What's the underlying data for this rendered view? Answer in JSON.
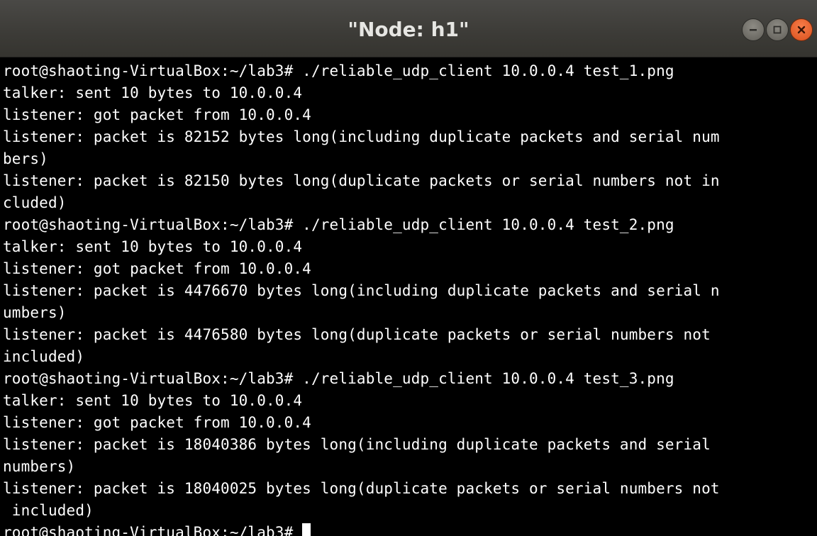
{
  "window": {
    "title": "\"Node: h1\"",
    "controls": {
      "minimize_icon": "minimize-icon",
      "maximize_icon": "maximize-icon",
      "close_icon": "close-icon"
    },
    "colors": {
      "titlebar": "#3d3c38",
      "close_button": "#e9612a",
      "terminal_bg": "#000000",
      "terminal_fg": "#ffffff"
    }
  },
  "terminal": {
    "lines": [
      "root@shaoting-VirtualBox:~/lab3# ./reliable_udp_client 10.0.0.4 test_1.png",
      "talker: sent 10 bytes to 10.0.0.4",
      "listener: got packet from 10.0.0.4",
      "listener: packet is 82152 bytes long(including duplicate packets and serial num",
      "bers)",
      "listener: packet is 82150 bytes long(duplicate packets or serial numbers not in",
      "cluded)",
      "root@shaoting-VirtualBox:~/lab3# ./reliable_udp_client 10.0.0.4 test_2.png",
      "talker: sent 10 bytes to 10.0.0.4",
      "listener: got packet from 10.0.0.4",
      "listener: packet is 4476670 bytes long(including duplicate packets and serial n",
      "umbers)",
      "listener: packet is 4476580 bytes long(duplicate packets or serial numbers not",
      "included)",
      "root@shaoting-VirtualBox:~/lab3# ./reliable_udp_client 10.0.0.4 test_3.png",
      "talker: sent 10 bytes to 10.0.0.4",
      "listener: got packet from 10.0.0.4",
      "listener: packet is 18040386 bytes long(including duplicate packets and serial",
      "numbers)",
      "listener: packet is 18040025 bytes long(duplicate packets or serial numbers not",
      " included)"
    ],
    "prompt": "root@shaoting-VirtualBox:~/lab3#"
  }
}
